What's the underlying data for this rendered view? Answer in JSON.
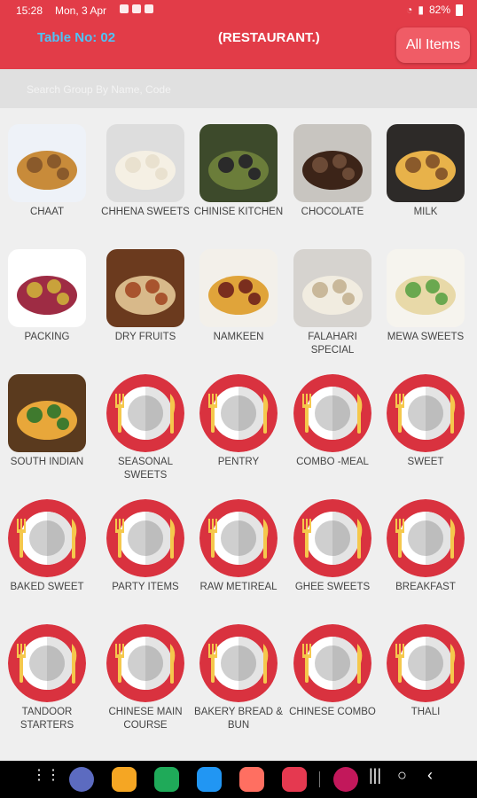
{
  "status": {
    "time": "15:28",
    "date": "Mon, 3 Apr",
    "battery": "82%"
  },
  "header": {
    "table_no": "Table No: 02",
    "title": "(RESTAURANT.)",
    "all_items": "All Items"
  },
  "search": {
    "placeholder": "Search Group By Name, Code"
  },
  "groups": [
    {
      "label": "CHAAT",
      "icon": "chaat-image"
    },
    {
      "label": "CHHENA SWEETS",
      "icon": "chhena-sweets-image"
    },
    {
      "label": "CHINISE KITCHEN",
      "icon": "chinise-kitchen-image"
    },
    {
      "label": "CHOCOLATE",
      "icon": "chocolate-image"
    },
    {
      "label": "MILK",
      "icon": "milk-image"
    },
    {
      "label": "PACKING",
      "icon": "packing-image"
    },
    {
      "label": "DRY FRUITS",
      "icon": "dry-fruits-image"
    },
    {
      "label": "NAMKEEN",
      "icon": "namkeen-image"
    },
    {
      "label": "FALAHARI SPECIAL",
      "icon": "falahari-image"
    },
    {
      "label": "MEWA SWEETS",
      "icon": "mewa-sweets-image"
    },
    {
      "label": "SOUTH INDIAN",
      "icon": "south-indian-image"
    },
    {
      "label": "SEASONAL SWEETS",
      "icon": "plate-icon"
    },
    {
      "label": "PENTRY",
      "icon": "plate-icon"
    },
    {
      "label": "COMBO -MEAL",
      "icon": "plate-icon"
    },
    {
      "label": "SWEET",
      "icon": "plate-icon"
    },
    {
      "label": "BAKED SWEET",
      "icon": "plate-icon"
    },
    {
      "label": "PARTY ITEMS",
      "icon": "plate-icon"
    },
    {
      "label": "RAW METIREAL",
      "icon": "plate-icon"
    },
    {
      "label": "GHEE SWEETS",
      "icon": "plate-icon"
    },
    {
      "label": "BREAKFAST",
      "icon": "plate-icon"
    },
    {
      "label": "TANDOOR STARTERS",
      "icon": "plate-icon"
    },
    {
      "label": "CHINESE MAIN COURSE",
      "icon": "plate-icon"
    },
    {
      "label": "BAKERY BREAD & Bun",
      "icon": "plate-icon"
    },
    {
      "label": "CHINESE COMBO",
      "icon": "plate-icon"
    },
    {
      "label": "THALI",
      "icon": "plate-icon"
    }
  ],
  "colors": {
    "accent": "#e23c48",
    "table_no": "#4fc3f7",
    "plate_red": "#d9323f"
  }
}
